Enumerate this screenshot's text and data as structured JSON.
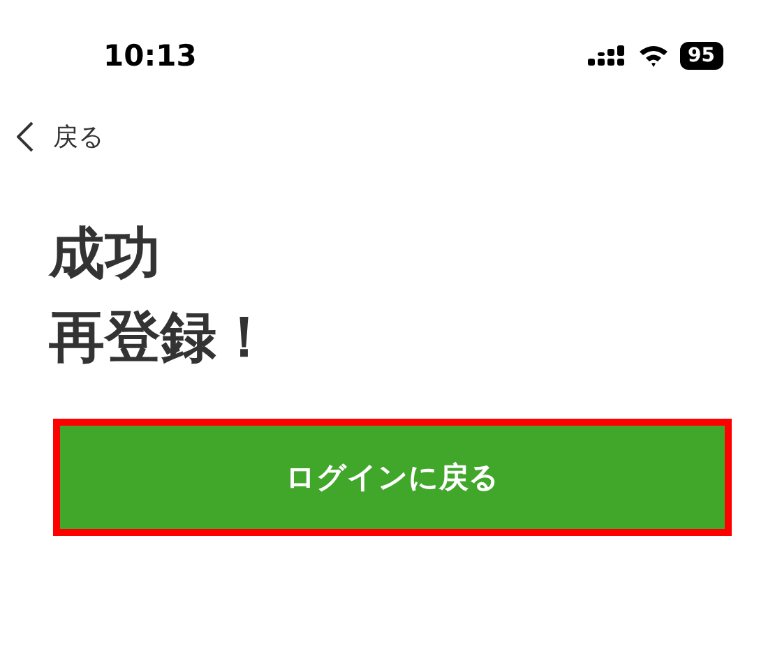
{
  "status_bar": {
    "time": "10:13",
    "battery": "95"
  },
  "back": {
    "label": "戻る"
  },
  "title_lines": [
    "成功",
    "再登録！"
  ],
  "button": {
    "label": "ログインに戻る",
    "highlighted": true
  }
}
